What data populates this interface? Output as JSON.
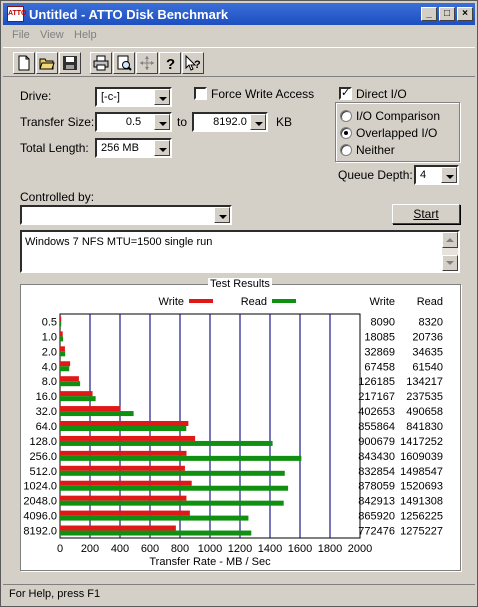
{
  "window": {
    "title": "Untitled - ATTO Disk Benchmark",
    "app_icon_text": "ATTO"
  },
  "menu": {
    "items": [
      "File",
      "View",
      "Help"
    ]
  },
  "toolbar": {
    "icons": [
      "new-file-icon",
      "open-folder-icon",
      "save-icon",
      "print-icon",
      "print-preview-icon",
      "move-icon",
      "help-icon",
      "context-help-icon"
    ]
  },
  "form": {
    "drive_label": "Drive:",
    "drive_value": "[-c-]",
    "transfer_size_label": "Transfer Size:",
    "transfer_size_from": "0.5",
    "transfer_to_label": "to",
    "transfer_size_to": "8192.0",
    "transfer_unit": "KB",
    "total_length_label": "Total Length:",
    "total_length_value": "256 MB",
    "force_write_label": "Force Write Access",
    "force_write_checked": false,
    "direct_io_label": "Direct I/O",
    "direct_io_checked": true,
    "io_comparison_label": "I/O Comparison",
    "overlapped_io_label": "Overlapped I/O",
    "neither_label": "Neither",
    "selected_mode": "Overlapped I/O",
    "queue_depth_label": "Queue Depth:",
    "queue_depth_value": "4",
    "controlled_by_label": "Controlled by:",
    "controlled_by_value": "",
    "start_label": "Start",
    "description": "Windows 7 NFS MTU=1500 single run"
  },
  "results": {
    "title": "Test Results",
    "write_legend": "Write",
    "read_legend": "Read",
    "write_col": "Write",
    "read_col": "Read",
    "write_color": "#e01818",
    "read_color": "#109010",
    "rows": [
      {
        "size": "0.5",
        "write": "8090",
        "read": "8320"
      },
      {
        "size": "1.0",
        "write": "18085",
        "read": "20736"
      },
      {
        "size": "2.0",
        "write": "32869",
        "read": "34635"
      },
      {
        "size": "4.0",
        "write": "67458",
        "read": "61540"
      },
      {
        "size": "8.0",
        "write": "126185",
        "read": "134217"
      },
      {
        "size": "16.0",
        "write": "217167",
        "read": "237535"
      },
      {
        "size": "32.0",
        "write": "402653",
        "read": "490658"
      },
      {
        "size": "64.0",
        "write": "855864",
        "read": "841830"
      },
      {
        "size": "128.0",
        "write": "900679",
        "read": "1417252"
      },
      {
        "size": "256.0",
        "write": "843430",
        "read": "1609039"
      },
      {
        "size": "512.0",
        "write": "832854",
        "read": "1498547"
      },
      {
        "size": "1024.0",
        "write": "878059",
        "read": "1520693"
      },
      {
        "size": "2048.0",
        "write": "842913",
        "read": "1491308"
      },
      {
        "size": "4096.0",
        "write": "865920",
        "read": "1256225"
      },
      {
        "size": "8192.0",
        "write": "772476",
        "read": "1275227"
      }
    ],
    "x_ticks": [
      "0",
      "200",
      "400",
      "600",
      "800",
      "1000",
      "1200",
      "1400",
      "1600",
      "1800",
      "2000"
    ],
    "x_label": "Transfer Rate - MB / Sec"
  },
  "chart_data": {
    "type": "bar",
    "title": "Test Results",
    "xlabel": "Transfer Rate - MB / Sec",
    "xlim": [
      0,
      2000
    ],
    "grid": true,
    "legend_position": "top",
    "categories": [
      "0.5",
      "1.0",
      "2.0",
      "4.0",
      "8.0",
      "16.0",
      "32.0",
      "64.0",
      "128.0",
      "256.0",
      "512.0",
      "1024.0",
      "2048.0",
      "4096.0",
      "8192.0"
    ],
    "series": [
      {
        "name": "Write",
        "values": [
          8090,
          18085,
          32869,
          67458,
          126185,
          217167,
          402653,
          855864,
          900679,
          843430,
          832854,
          878059,
          842913,
          865920,
          772476
        ]
      },
      {
        "name": "Read",
        "values": [
          8320,
          20736,
          34635,
          61540,
          134217,
          237535,
          490658,
          841830,
          1417252,
          1609039,
          1498547,
          1520693,
          1491308,
          1256225,
          1275227
        ]
      }
    ]
  },
  "status": {
    "text": "For Help, press F1"
  }
}
